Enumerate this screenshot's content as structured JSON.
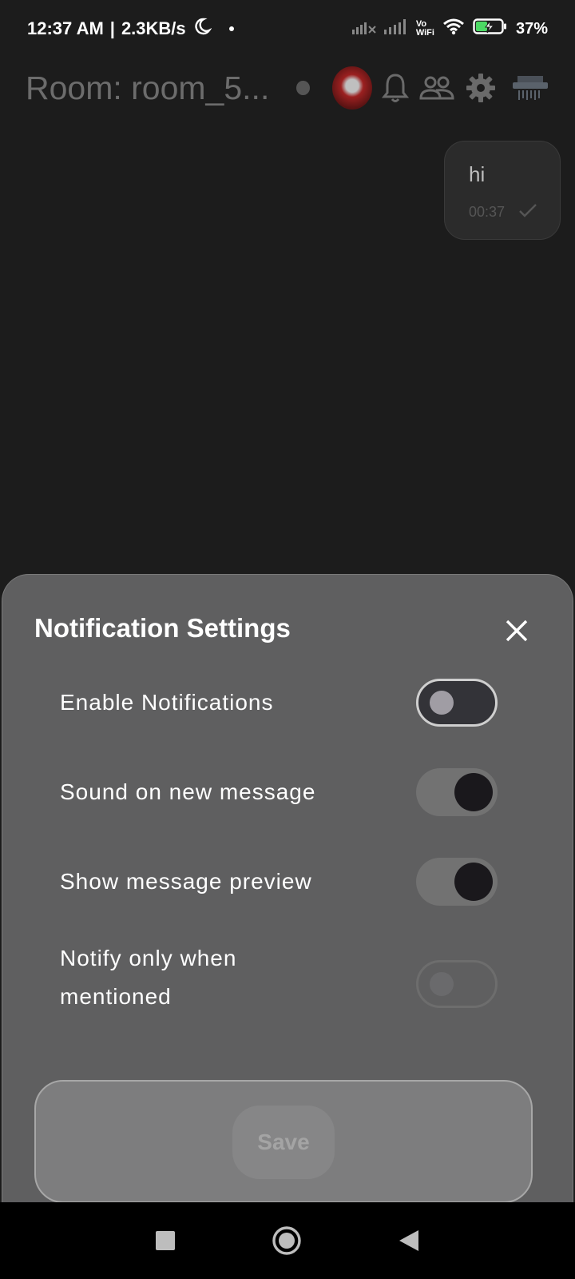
{
  "status_bar": {
    "time": "12:37 AM",
    "network_speed": "2.3KB/s",
    "icons": [
      "moon-icon",
      "signal-x-icon",
      "signal-icon",
      "vowifi-icon",
      "wifi-icon",
      "battery-charging-icon"
    ],
    "vowifi_label": "Vo\nWiFi",
    "battery_percent": "37%"
  },
  "header": {
    "room_title": "Room: room_5...",
    "icons": [
      "presence-dot",
      "avatar",
      "bell-icon",
      "people-icon",
      "gear-icon",
      "shredder-icon"
    ]
  },
  "messages": [
    {
      "text": "hi",
      "time": "00:37",
      "status_icon": "check-icon"
    }
  ],
  "notification_sheet": {
    "title": "Notification Settings",
    "close_icon": "close-icon",
    "settings": [
      {
        "label": "Enable Notifications",
        "enabled": false,
        "disabled": false
      },
      {
        "label": "Sound on new message",
        "enabled": true,
        "disabled": false
      },
      {
        "label": "Show message preview",
        "enabled": true,
        "disabled": false
      },
      {
        "label": "Notify only when\nmentioned",
        "enabled": false,
        "disabled": true
      }
    ],
    "save_label": "Save"
  },
  "navigation_bar": {
    "icons": [
      "recent-apps-icon",
      "home-icon",
      "back-icon"
    ]
  },
  "colors": {
    "background": "#1c1c1c",
    "sheet": "#5f5f60",
    "toggle_knob_on": "#1a181c"
  }
}
